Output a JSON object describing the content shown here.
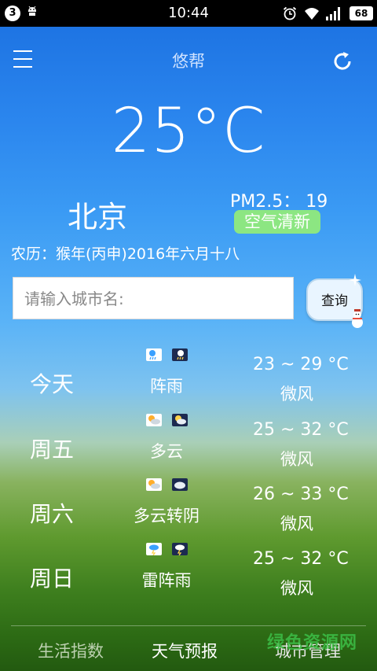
{
  "status_bar": {
    "notification_count": "3",
    "time": "10:44",
    "battery": "68",
    "icons": [
      "android-icon",
      "alarm-icon",
      "wifi-icon",
      "signal-icon",
      "battery-icon"
    ]
  },
  "header": {
    "title": "悠帮",
    "menu_icon": "menu-icon",
    "refresh_icon": "refresh-icon"
  },
  "current": {
    "temperature": "25°C",
    "city": "北京",
    "pm25_text": "PM2.5： 19",
    "air_quality": "空气清新",
    "lunar_date": "农历：猴年(丙申)2016年六月十八"
  },
  "search": {
    "placeholder": "请输入城市名:",
    "button_label": "查询"
  },
  "forecast": [
    {
      "day": "今天",
      "condition": "阵雨",
      "temp_range": "23 ~ 29 °C",
      "wind": "微风",
      "day_icon": "shower-icon",
      "night_icon": "shower-night-icon"
    },
    {
      "day": "周五",
      "condition": "多云",
      "temp_range": "25 ~ 32 °C",
      "wind": "微风",
      "day_icon": "cloudy-icon",
      "night_icon": "cloudy-night-icon"
    },
    {
      "day": "周六",
      "condition": "多云转阴",
      "temp_range": "26 ~ 33 °C",
      "wind": "微风",
      "day_icon": "cloudy-icon",
      "night_icon": "overcast-icon"
    },
    {
      "day": "周日",
      "condition": "雷阵雨",
      "temp_range": "25 ~ 32 °C",
      "wind": "微风",
      "day_icon": "thunderstorm-icon",
      "night_icon": "thunderstorm-night-icon"
    }
  ],
  "bottom_nav": {
    "tabs": [
      {
        "label": "生活指数"
      },
      {
        "label": "天气预报"
      },
      {
        "label": "城市管理"
      }
    ]
  },
  "watermark": "绿色资源网",
  "colors": {
    "air_quality_badge": "#8ce682",
    "status_bar": "#000000"
  }
}
